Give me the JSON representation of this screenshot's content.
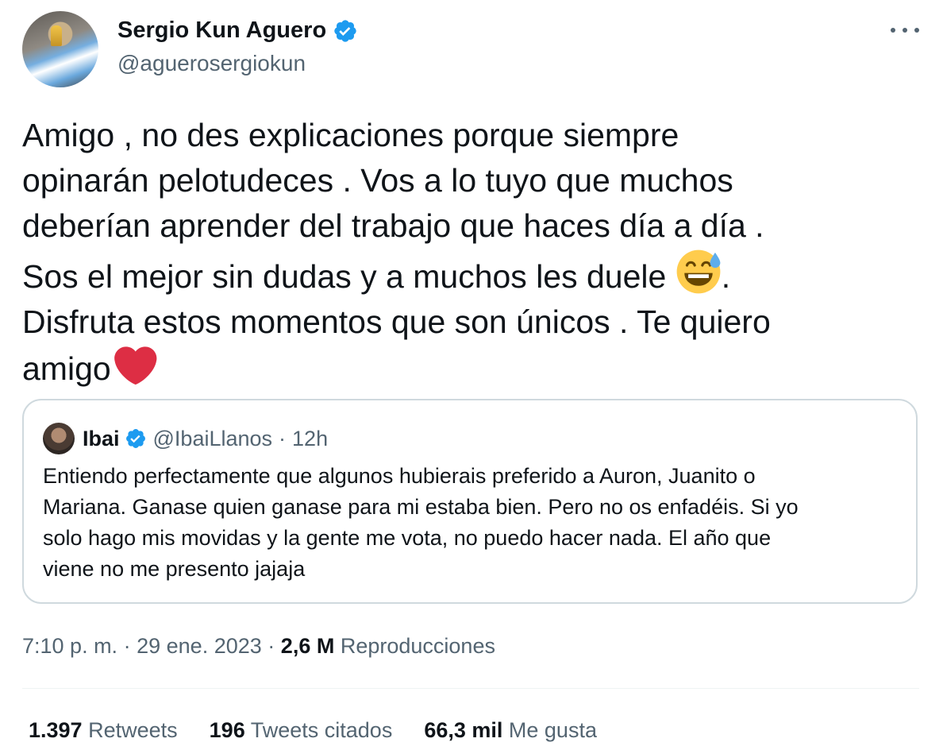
{
  "author": {
    "name": "Sergio Kun Aguero",
    "handle": "@aguerosergiokun",
    "verified": true
  },
  "tweet": {
    "lines": [
      "Amigo , no des explicaciones porque siempre",
      "opinarán pelotudeces . Vos a lo tuyo que muchos",
      "deberían aprender del trabajo que haces día a día .",
      "Sos el mejor sin dudas y a muchos les duele",
      ".",
      "Disfruta estos momentos que son únicos . Te quiero",
      "amigo"
    ],
    "emojis": [
      "grinning-sweat-emoji",
      "red-heart-emoji"
    ]
  },
  "quote": {
    "name": "Ibai",
    "handle": "@IbaiLlanos",
    "separator": "·",
    "time": "12h",
    "lines": [
      "Entiendo perfectamente que algunos hubierais preferido a Auron, Juanito o",
      "Mariana. Ganase quien ganase para mi estaba bien. Pero no os enfadéis. Si yo",
      "solo hago mis movidas y la gente me vota, no puedo hacer nada. El año que",
      "viene no me presento jajaja"
    ]
  },
  "meta": {
    "time": "7:10 p. m.",
    "sep": "·",
    "date": "29 ene. 2023",
    "views_count": "2,6 M",
    "views_label": "Reproducciones"
  },
  "stats": {
    "retweets_count": "1.397",
    "retweets_label": "Retweets",
    "quotes_count": "196",
    "quotes_label": "Tweets citados",
    "likes_count": "66,3 mil",
    "likes_label": "Me gusta"
  },
  "colors": {
    "text": "#0f1419",
    "secondary": "#536471",
    "verified": "#1d9bf0",
    "border": "#cfd9de",
    "heart": "#dd2e44"
  }
}
